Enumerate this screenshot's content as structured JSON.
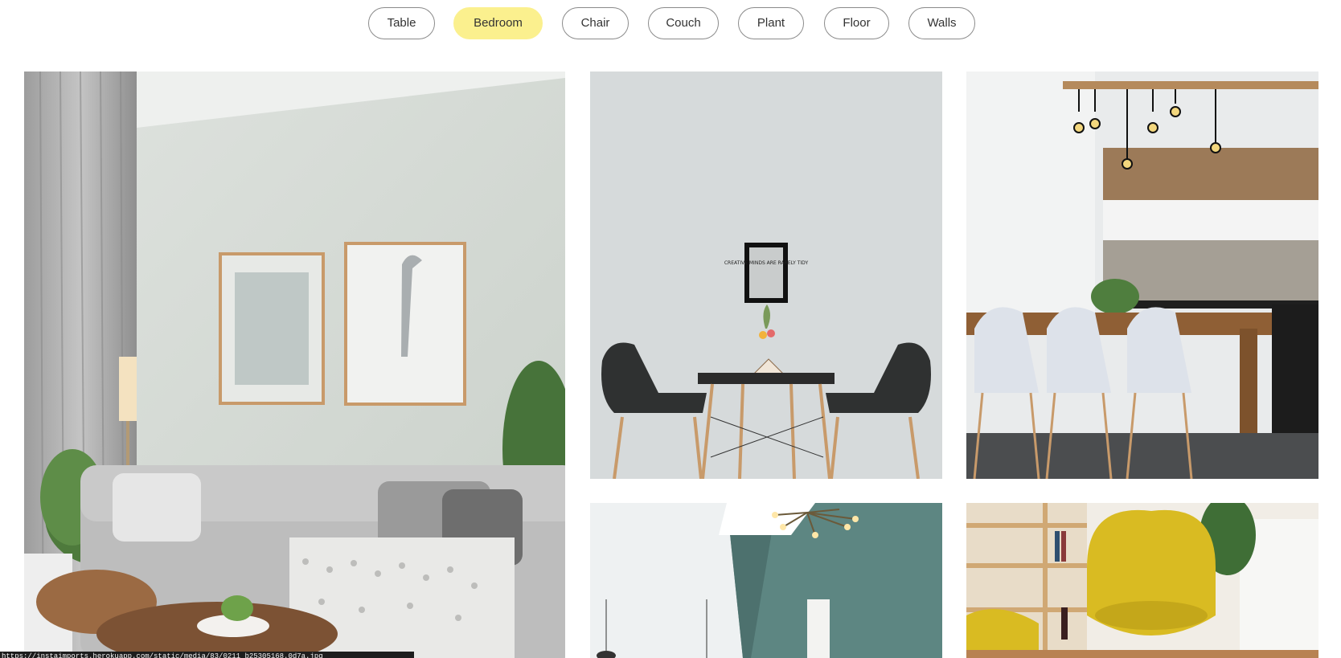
{
  "filters": [
    {
      "label": "Table",
      "active": false
    },
    {
      "label": "Bedroom",
      "active": true
    },
    {
      "label": "Chair",
      "active": false
    },
    {
      "label": "Couch",
      "active": false
    },
    {
      "label": "Plant",
      "active": false
    },
    {
      "label": "Floor",
      "active": false
    },
    {
      "label": "Walls",
      "active": false
    }
  ],
  "gallery": {
    "images": [
      {
        "subject": "living room with grey sofa, framed prints, plants and curtains"
      },
      {
        "subject": "small black dining table with two black chairs and a framed quote sign"
      },
      {
        "subject": "kitchen with wooden table, white chairs and hanging bulb lamps"
      },
      {
        "subject": "teal wall room with modern ceiling light fixture"
      },
      {
        "subject": "yellow armchairs beside wooden shelving and plant"
      }
    ],
    "sign_text": "CREATIVE MINDS ARE RARELY TIDY"
  },
  "status_bar": {
    "url": "https://instaimports.herokuapp.com/static/media/83/0211_b25305168.0d7a.jpg"
  },
  "colors": {
    "chip_active": "#fbf08e",
    "chip_border": "#8a8a8a",
    "wall_grey": "#d8dcdd",
    "wall_teal": "#5d8682",
    "chair_yellow": "#d9bb22"
  }
}
